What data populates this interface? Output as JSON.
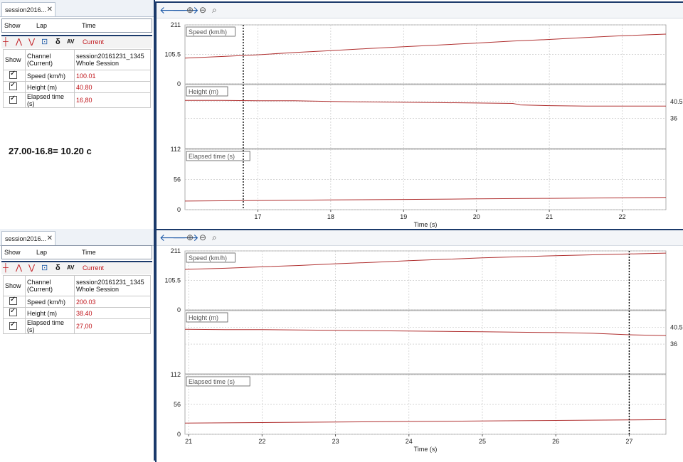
{
  "panels": [
    {
      "tab_title": "session2016...",
      "lap_headers": [
        "Show",
        "Lap",
        "Time"
      ],
      "toolbar_current": "Current",
      "table_headers": {
        "show": "Show",
        "channel": "Channel\n(Current)",
        "session": "session20161231_1345\nWhole Session"
      },
      "rows": [
        {
          "channel": "Speed (km/h)",
          "value": "100.01"
        },
        {
          "channel": "Height (m)",
          "value": "40.80"
        },
        {
          "channel": "Elapsed time (s)",
          "value": "16,80"
        }
      ]
    },
    {
      "tab_title": "session2016...",
      "lap_headers": [
        "Show",
        "Lap",
        "Time"
      ],
      "toolbar_current": "Current",
      "table_headers": {
        "show": "Show",
        "channel": "Channel\n(Current)",
        "session": "session20161231_1345\nWhole Session"
      },
      "rows": [
        {
          "channel": "Speed (km/h)",
          "value": "200.03"
        },
        {
          "channel": "Height (m)",
          "value": "38.40"
        },
        {
          "channel": "Elapsed time (s)",
          "value": "27,00"
        }
      ]
    }
  ],
  "annotation": "27.00-16.8= 10.20 c",
  "colors": {
    "trace": "#b03030",
    "cursor": "#000000",
    "frame": "#1b3a6b",
    "value": "#c0141a"
  },
  "icons": [
    "back-arrow-icon",
    "forward-arrow-icon",
    "zoom-in-icon",
    "zoom-out-icon",
    "zoom-fit-icon"
  ],
  "chart_data": [
    {
      "type": "line",
      "xlabel": "Time (s)",
      "xlim": [
        16.0,
        22.6
      ],
      "xticks": [
        17,
        18,
        19,
        20,
        21,
        22
      ],
      "cursor_x": 16.8,
      "grid": true,
      "subplots": [
        {
          "name": "Speed (km/h)",
          "yticks": [
            "211",
            "105.5",
            "0"
          ],
          "ylim": [
            0,
            211
          ],
          "ytick_side": "left",
          "x": [
            16.0,
            16.5,
            17.0,
            17.5,
            18.0,
            18.5,
            19.0,
            19.5,
            20.0,
            20.5,
            21.0,
            21.5,
            22.0,
            22.6
          ],
          "y": [
            92,
            98,
            104,
            112,
            119,
            126,
            133,
            139,
            146,
            153,
            159,
            166,
            172,
            178
          ]
        },
        {
          "name": "Height (m)",
          "yticks": [
            "40.5",
            "36"
          ],
          "ylim": [
            28,
            45
          ],
          "ytick_side": "right",
          "x": [
            16.0,
            16.5,
            17.0,
            17.5,
            18.0,
            18.5,
            19.0,
            19.5,
            20.0,
            20.5,
            20.6,
            21.0,
            21.5,
            22.0,
            22.6
          ],
          "y": [
            40.8,
            40.8,
            40.7,
            40.7,
            40.5,
            40.4,
            40.3,
            40.2,
            40.1,
            40.0,
            39.6,
            39.4,
            39.3,
            39.3,
            39.3
          ]
        },
        {
          "name": "Elapsed time (s)",
          "yticks": [
            "112",
            "56",
            "0"
          ],
          "ylim": [
            0,
            112
          ],
          "ytick_side": "left",
          "x": [
            16.0,
            17.0,
            18.0,
            19.0,
            20.0,
            21.0,
            22.0,
            22.6
          ],
          "y": [
            16.0,
            17.0,
            18.0,
            19.0,
            20.0,
            21.0,
            22.0,
            22.6
          ]
        }
      ]
    },
    {
      "type": "line",
      "xlabel": "Time (s)",
      "xlim": [
        20.95,
        27.5
      ],
      "xticks": [
        21,
        22,
        23,
        24,
        25,
        26,
        27
      ],
      "cursor_x": 27.0,
      "grid": true,
      "subplots": [
        {
          "name": "Speed (km/h)",
          "yticks": [
            "211",
            "105.5",
            "0"
          ],
          "ylim": [
            0,
            211
          ],
          "ytick_side": "left",
          "x": [
            20.95,
            21.5,
            22.0,
            22.5,
            23.0,
            23.5,
            24.0,
            24.5,
            25.0,
            25.5,
            26.0,
            26.5,
            27.0,
            27.5
          ],
          "y": [
            145,
            149,
            154,
            159,
            165,
            170,
            176,
            181,
            186,
            190,
            194,
            197,
            200,
            203
          ]
        },
        {
          "name": "Height (m)",
          "yticks": [
            "40.5",
            "36"
          ],
          "ylim": [
            28,
            45
          ],
          "ytick_side": "right",
          "x": [
            20.95,
            21.5,
            22.0,
            22.5,
            23.0,
            23.5,
            24.0,
            24.5,
            25.0,
            25.5,
            26.0,
            26.5,
            27.0,
            27.5
          ],
          "y": [
            40.0,
            39.9,
            39.9,
            39.8,
            39.7,
            39.6,
            39.5,
            39.4,
            39.3,
            39.2,
            39.1,
            38.9,
            38.5,
            38.3
          ]
        },
        {
          "name": "Elapsed time (s)",
          "yticks": [
            "112",
            "56",
            "0"
          ],
          "ylim": [
            0,
            112
          ],
          "ytick_side": "left",
          "x": [
            20.95,
            22.0,
            23.0,
            24.0,
            25.0,
            26.0,
            27.0,
            27.5
          ],
          "y": [
            20.95,
            22.0,
            23.0,
            24.0,
            25.0,
            26.0,
            27.0,
            27.5
          ]
        }
      ]
    }
  ]
}
